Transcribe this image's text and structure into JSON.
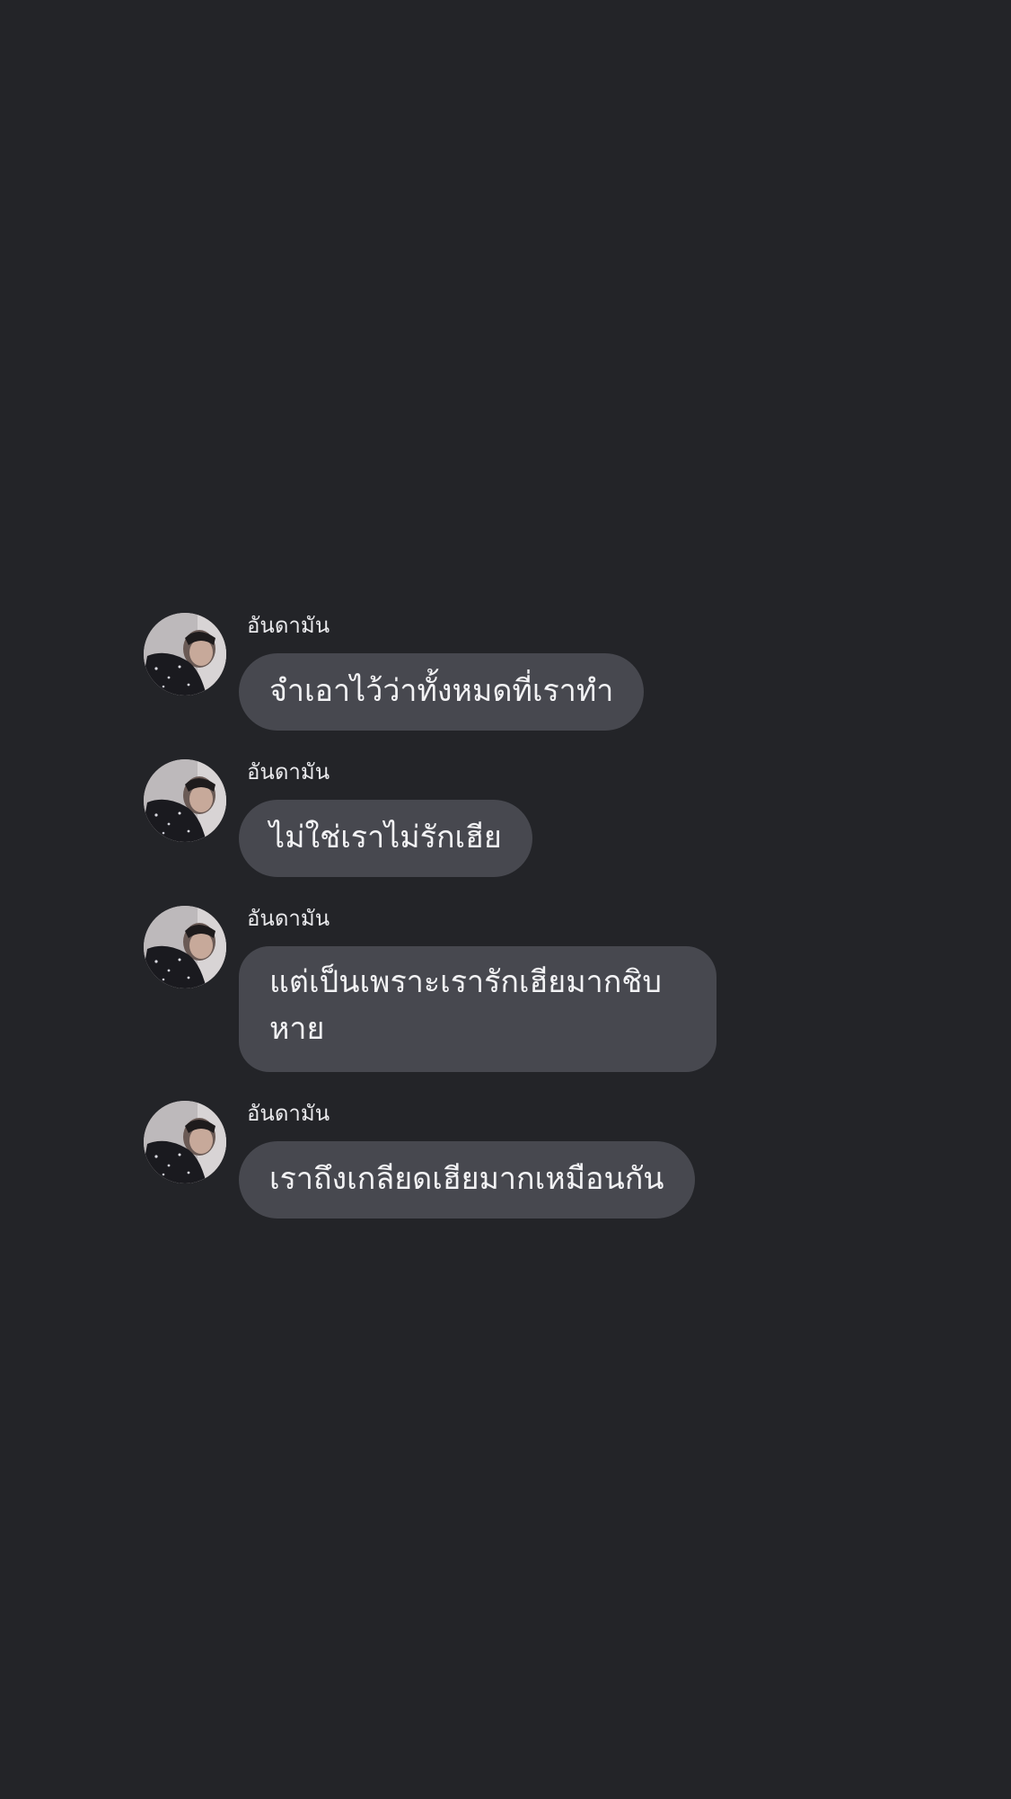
{
  "colors": {
    "background": "#232428",
    "bubble": "#47484f",
    "text": "#f2f2f4",
    "sender": "#e9e9ec"
  },
  "messages": [
    {
      "sender": "อันดามัน",
      "text": "จำเอาไว้ว่าทั้งหมดที่เราทำ",
      "avatar_icon": "user-avatar"
    },
    {
      "sender": "อันดามัน",
      "text": "ไม่ใช่เราไม่รักเฮีย",
      "avatar_icon": "user-avatar"
    },
    {
      "sender": "อันดามัน",
      "text": "แต่เป็นเพราะเรารักเฮียมากชิบหาย",
      "avatar_icon": "user-avatar"
    },
    {
      "sender": "อันดามัน",
      "text": "เราถึงเกลียดเฮียมากเหมือนกัน",
      "avatar_icon": "user-avatar"
    }
  ]
}
